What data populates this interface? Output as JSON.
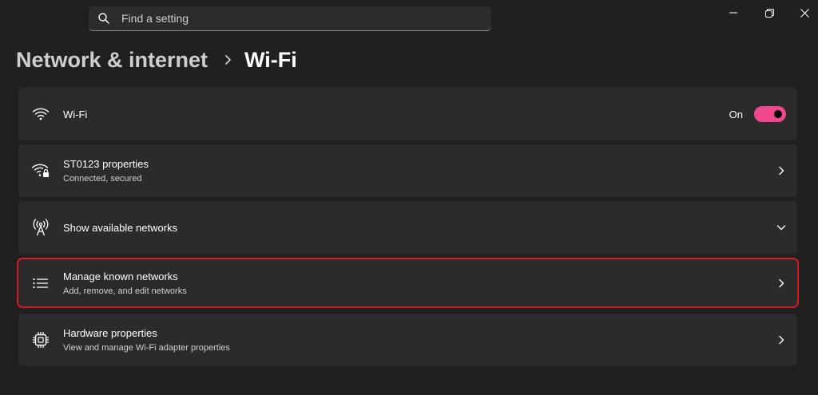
{
  "search": {
    "placeholder": "Find a setting",
    "icon": "search-icon"
  },
  "window_controls": [
    "minimize",
    "restore",
    "close"
  ],
  "breadcrumb": {
    "parent": "Network & internet",
    "current": "Wi-Fi"
  },
  "items": [
    {
      "title": "Wi-Fi",
      "subtitle": "",
      "icon": "wifi-icon",
      "toggle": {
        "label": "On",
        "state": true
      }
    },
    {
      "title": "ST0123 properties",
      "subtitle": "Connected, secured",
      "icon": "wifi-secured-icon",
      "trail": "chevron-right"
    },
    {
      "title": "Show available networks",
      "subtitle": "",
      "icon": "antenna-icon",
      "trail": "chevron-down"
    },
    {
      "title": "Manage known networks",
      "subtitle": "Add, remove, and edit networks",
      "icon": "list-icon",
      "trail": "chevron-right",
      "highlighted": true
    },
    {
      "title": "Hardware properties",
      "subtitle": "View and manage Wi-Fi adapter properties",
      "icon": "chip-icon",
      "trail": "chevron-right"
    }
  ],
  "colors": {
    "background": "#202020",
    "card": "#2b2b2b",
    "accent": "#f0488f",
    "highlight": "#d51a22"
  }
}
